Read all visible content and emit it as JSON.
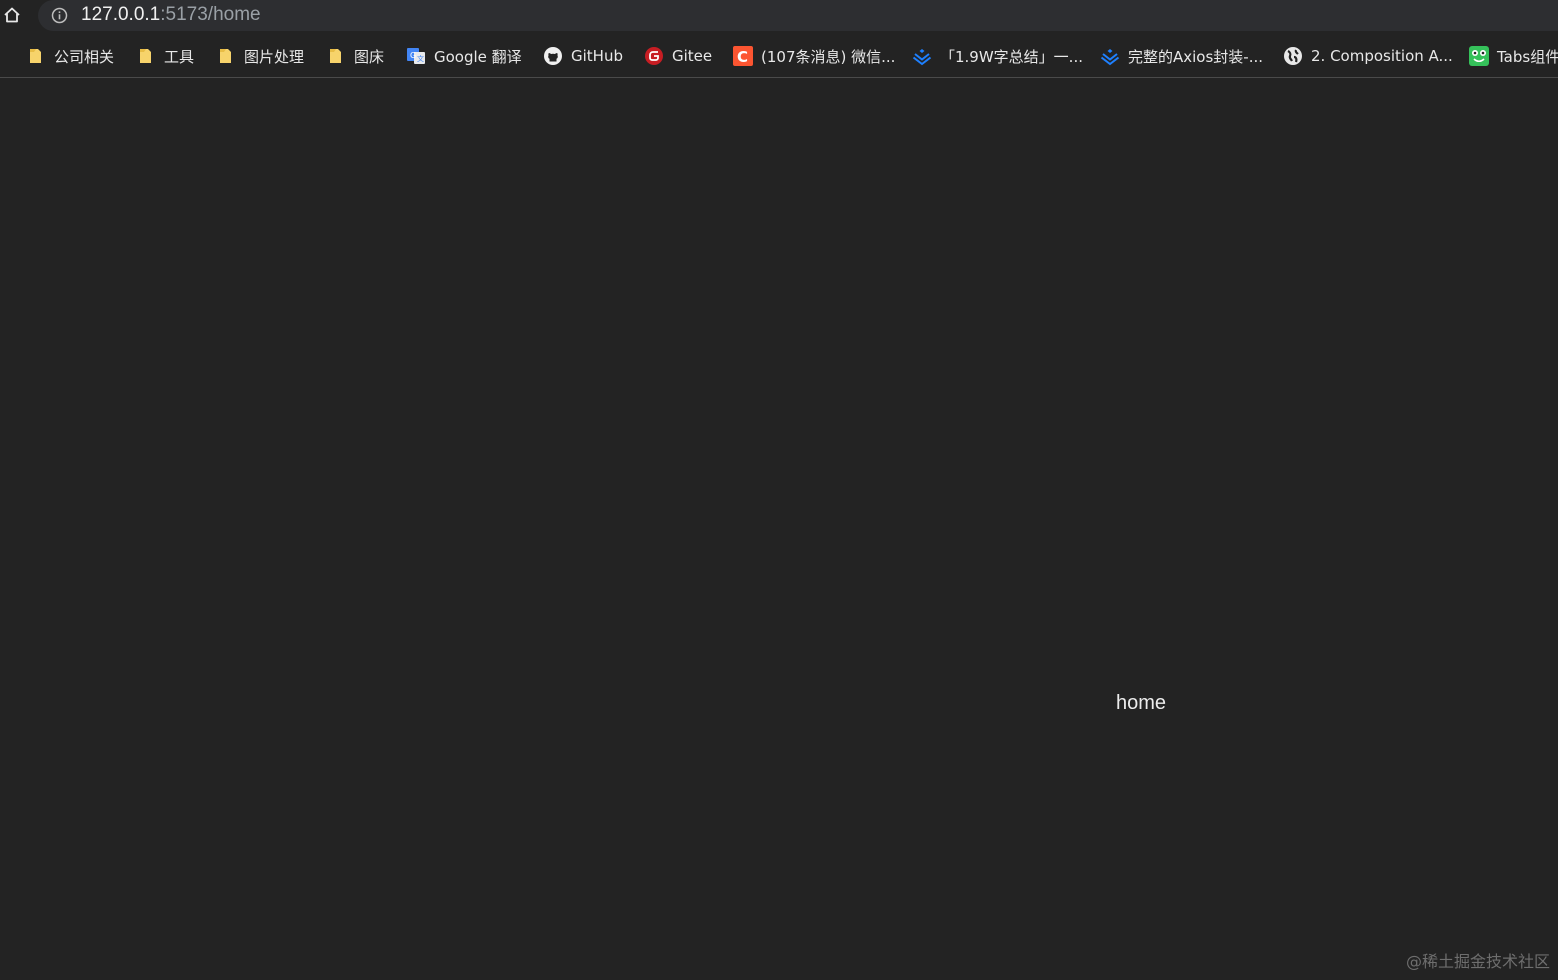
{
  "address_bar": {
    "host": "127.0.0.1",
    "path": ":5173/home"
  },
  "bookmarks": [
    {
      "label": "公司相关",
      "icon": "folder-icon"
    },
    {
      "label": "工具",
      "icon": "folder-icon"
    },
    {
      "label": "图片处理",
      "icon": "folder-icon"
    },
    {
      "label": "图床",
      "icon": "folder-icon"
    },
    {
      "label": "Google 翻译",
      "icon": "google-translate-icon"
    },
    {
      "label": "GitHub",
      "icon": "github-icon"
    },
    {
      "label": "Gitee",
      "icon": "gitee-icon"
    },
    {
      "label": "(107条消息) 微信...",
      "icon": "csdn-icon"
    },
    {
      "label": "「1.9W字总结」一...",
      "icon": "juejin-icon"
    },
    {
      "label": "完整的Axios封装-...",
      "icon": "juejin-icon"
    },
    {
      "label": "2. Composition A...",
      "icon": "globe-icon"
    },
    {
      "label": "Tabs组件",
      "icon": "frog-icon"
    }
  ],
  "page": {
    "text": "home"
  },
  "watermark": "@稀土掘金技术社区",
  "colors": {
    "background": "#232323",
    "folder": "#f7d36b",
    "gitee": "#c71d23",
    "csdn": "#fc5531",
    "juejin": "#1e80ff"
  }
}
